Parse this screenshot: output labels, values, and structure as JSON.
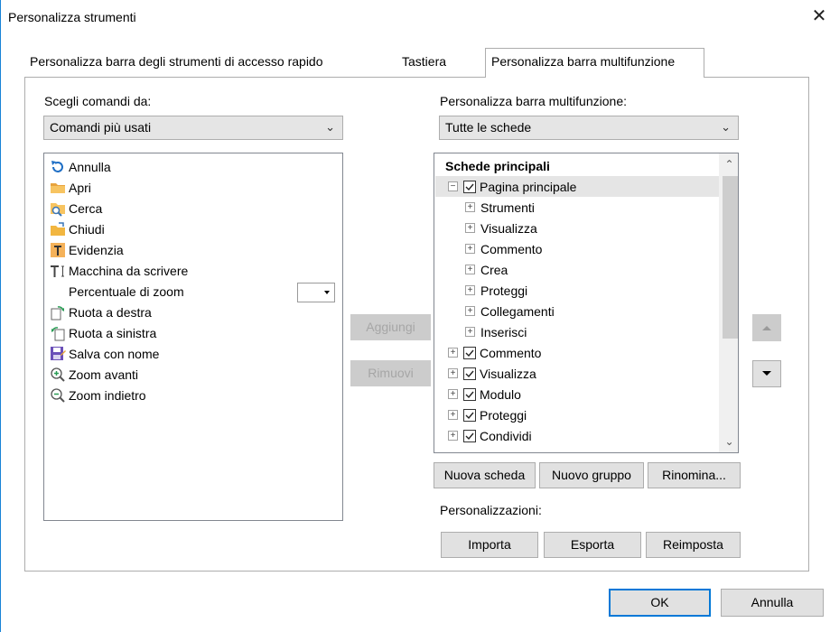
{
  "window": {
    "title": "Personalizza strumenti",
    "close": "✕"
  },
  "tabs": [
    {
      "label": "Personalizza barra degli strumenti di accesso rapido"
    },
    {
      "label": "Tastiera"
    },
    {
      "label": "Personalizza barra multifunzione"
    }
  ],
  "left": {
    "label": "Scegli comandi da:",
    "select_value": "Comandi più usati",
    "commands": [
      {
        "label": "Annulla",
        "icon": "undo-icon"
      },
      {
        "label": "Apri",
        "icon": "folder-icon"
      },
      {
        "label": "Cerca",
        "icon": "search-icon"
      },
      {
        "label": "Chiudi",
        "icon": "close-folder-icon"
      },
      {
        "label": "Evidenzia",
        "icon": "highlight-icon"
      },
      {
        "label": "Macchina da scrivere",
        "icon": "typewriter-icon"
      },
      {
        "label": "Percentuale di zoom",
        "icon": ""
      },
      {
        "label": "Ruota a destra",
        "icon": "rotate-right-icon"
      },
      {
        "label": "Ruota a sinistra",
        "icon": "rotate-left-icon"
      },
      {
        "label": "Salva con nome",
        "icon": "save-as-icon"
      },
      {
        "label": "Zoom avanti",
        "icon": "zoom-in-icon"
      },
      {
        "label": "Zoom indietro",
        "icon": "zoom-out-icon"
      }
    ]
  },
  "middle": {
    "add": "Aggiungi",
    "remove": "Rimuovi"
  },
  "right": {
    "label": "Personalizza barra multifunzione:",
    "select_value": "Tutte le schede",
    "tree_header": "Schede principali",
    "tree": [
      {
        "label": "Pagina principale",
        "level": 0,
        "expander": "−",
        "checked": true
      },
      {
        "label": "Strumenti",
        "level": 1,
        "expander": "+",
        "checked": null
      },
      {
        "label": "Visualizza",
        "level": 1,
        "expander": "+",
        "checked": null
      },
      {
        "label": "Commento",
        "level": 1,
        "expander": "+",
        "checked": null
      },
      {
        "label": "Crea",
        "level": 1,
        "expander": "+",
        "checked": null
      },
      {
        "label": "Proteggi",
        "level": 1,
        "expander": "+",
        "checked": null
      },
      {
        "label": "Collegamenti",
        "level": 1,
        "expander": "+",
        "checked": null
      },
      {
        "label": "Inserisci",
        "level": 1,
        "expander": "+",
        "checked": null
      },
      {
        "label": "Commento",
        "level": 0,
        "expander": "+",
        "checked": true
      },
      {
        "label": "Visualizza",
        "level": 0,
        "expander": "+",
        "checked": true
      },
      {
        "label": "Modulo",
        "level": 0,
        "expander": "+",
        "checked": true
      },
      {
        "label": "Proteggi",
        "level": 0,
        "expander": "+",
        "checked": true
      },
      {
        "label": "Condividi",
        "level": 0,
        "expander": "+",
        "checked": true
      }
    ],
    "new_tab": "Nuova scheda",
    "new_group": "Nuovo gruppo",
    "rename": "Rinomina...",
    "customizations_label": "Personalizzazioni:",
    "import": "Importa",
    "export": "Esporta",
    "reset": "Reimposta"
  },
  "footer": {
    "ok": "OK",
    "cancel": "Annulla"
  },
  "colors": {
    "accent": "#0078d7",
    "window_border": "#1883d7",
    "selected_row": "#e5e5e5"
  }
}
